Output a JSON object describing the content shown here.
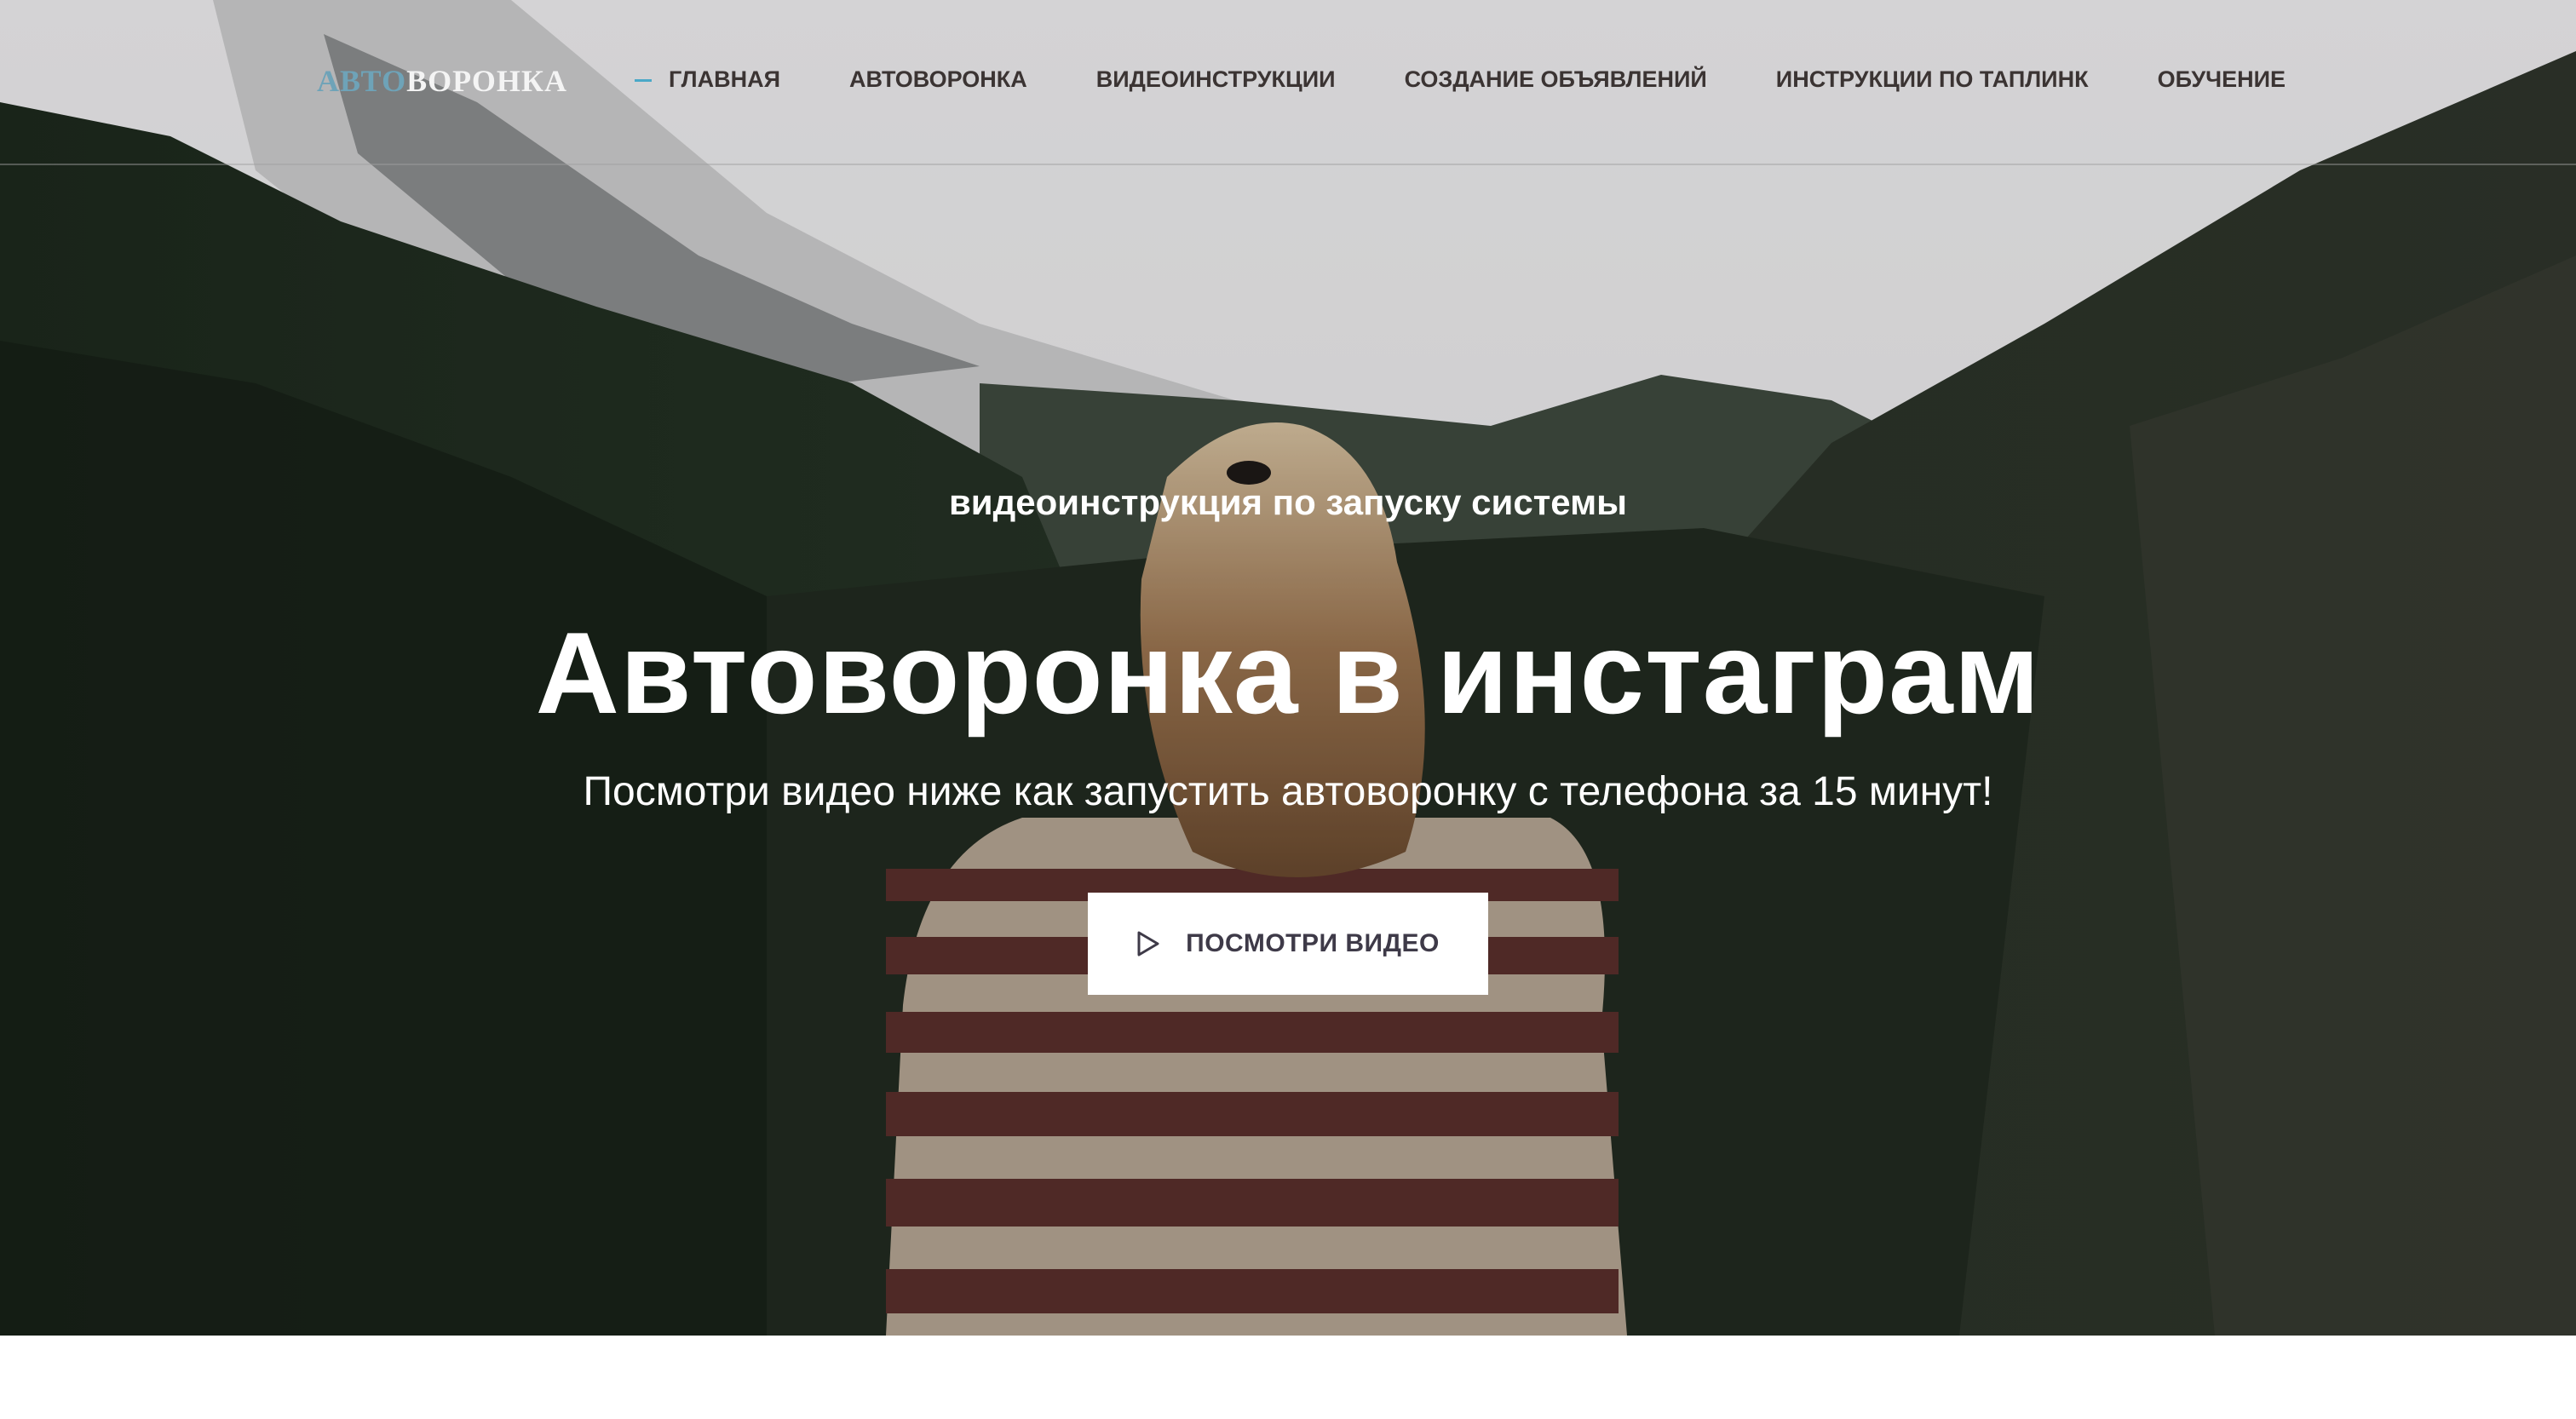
{
  "logo": {
    "part_a": "АВТО",
    "part_b": "ВОРОНКА"
  },
  "nav": {
    "items": [
      {
        "label": "ГЛАВНАЯ",
        "active": true
      },
      {
        "label": "АВТОВОРОНКА"
      },
      {
        "label": "ВИДЕОИНСТРУКЦИИ"
      },
      {
        "label": "СОЗДАНИЕ ОБЪЯВЛЕНИЙ"
      },
      {
        "label": "ИНСТРУКЦИИ ПО ТАПЛИНК"
      },
      {
        "label": "ОБУЧЕНИЕ"
      }
    ]
  },
  "hero": {
    "subtitle": "видеоинструкция по запуску системы",
    "title": "Автоворонка в инстаграм",
    "lead": "Посмотри видео ниже как запустить автоворонку с телефона за 15 минут!",
    "cta_label": "ПОСМОТРИ ВИДЕО",
    "cta_icon": "play-icon"
  },
  "colors": {
    "accent": "#4aa8c8",
    "nav_text": "#3b3433",
    "logo_accent": "#6ea3b8",
    "button_bg": "#ffffff",
    "button_text": "#3e3a48"
  }
}
